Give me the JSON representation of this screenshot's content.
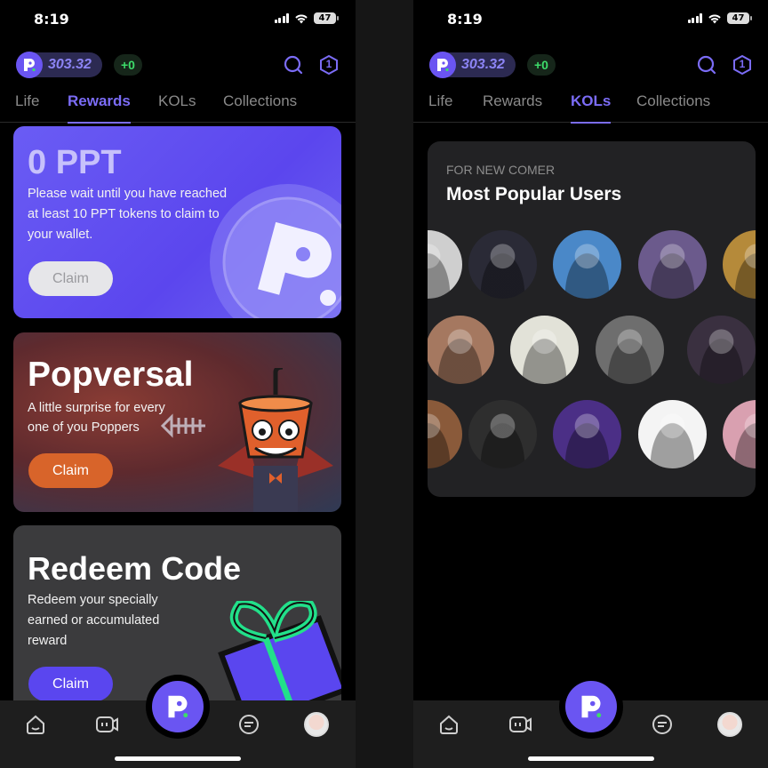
{
  "status_bar": {
    "time": "8:19",
    "battery": "47"
  },
  "header": {
    "balance": "303.32",
    "delta": "+0",
    "badge": "1"
  },
  "tabs": [
    "Life",
    "Rewards",
    "KOLs",
    "Collections"
  ],
  "left_screen": {
    "active_tab": "Rewards",
    "ppt_card": {
      "title": "0 PPT",
      "body": [
        "Please wait until you have reached",
        "at least 10 PPT tokens to claim to",
        "your wallet."
      ],
      "button": "Claim"
    },
    "popversal_card": {
      "title": "Popversal",
      "body": [
        "A little surprise for every",
        "one of you Poppers"
      ],
      "button": "Claim"
    },
    "redeem_card": {
      "title": "Redeem Code",
      "body": [
        "Redeem your specially",
        "earned or accumulated",
        "reward"
      ],
      "button": "Claim"
    }
  },
  "right_screen": {
    "active_tab": "KOLs",
    "kol_section": {
      "eyebrow": "FOR NEW COMER",
      "title": "Most Popular Users"
    },
    "users": [
      {
        "icon": "avatar-bear-cartoon",
        "color": "#cfcfcf"
      },
      {
        "icon": "avatar-crowd-photo",
        "color": "#2a2a36"
      },
      {
        "icon": "avatar-man-portrait",
        "color": "#4a88c8"
      },
      {
        "icon": "avatar-stage-screen",
        "color": "#6b5a8c"
      },
      {
        "icon": "avatar-gold-badge",
        "color": "#b58a3a"
      },
      {
        "icon": "avatar-woman-photo",
        "color": "#a57860"
      },
      {
        "icon": "avatar-robot-ape",
        "color": "#e2e2d8"
      },
      {
        "icon": "avatar-suit-person",
        "color": "#6e6e6e"
      },
      {
        "icon": "avatar-anime-purple-hair",
        "color": "#3a3040"
      },
      {
        "icon": "avatar-fox-photo",
        "color": "#8a5a3a"
      },
      {
        "icon": "avatar-dog-photo",
        "color": "#2e2e2e"
      },
      {
        "icon": "avatar-gaming-room",
        "color": "#4b2f86"
      },
      {
        "icon": "avatar-popcorn",
        "color": "#f4f4f4"
      },
      {
        "icon": "avatar-pink-woman",
        "color": "#d9a0b0"
      }
    ]
  },
  "bottom_nav": [
    "home-icon",
    "camera-icon",
    "pop-logo-icon",
    "chat-icon",
    "profile-avatar"
  ],
  "colors": {
    "accent": "#6a55f2",
    "green": "#3ddc6a",
    "orange": "#d8642a",
    "background": "#000000"
  }
}
